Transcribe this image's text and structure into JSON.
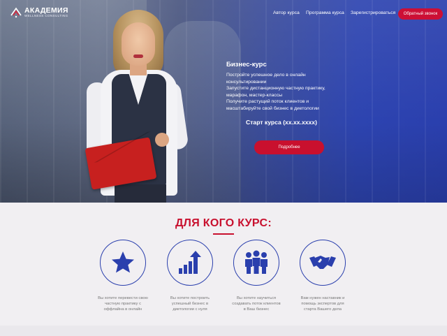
{
  "header": {
    "logo": {
      "name": "АКАДЕМИЯ",
      "subtitle": "WELLNESS CONSULTING",
      "icon": "academy-logo-icon"
    },
    "nav": [
      {
        "label": "Автор курса"
      },
      {
        "label": "Программа курса"
      },
      {
        "label": "Зарегистрироваться"
      }
    ],
    "callback_button": "Обратный звонок"
  },
  "hero": {
    "title": "Бизнес-курс",
    "description_lines": [
      "Постройте успешное дело в онлайн",
      "консультировании",
      "Запустите дистанционную частную практику,",
      "марафон, мастер-классы",
      "Получите растущий поток клиентов и",
      "масштабируйте свой бизнес в диетологии"
    ],
    "start": "Старт курса (xx.xx.xxxx)",
    "details_button": "Подробнее"
  },
  "audience": {
    "title": "ДЛЯ КОГО КУРС:",
    "items": [
      {
        "icon": "star-icon",
        "lines": [
          "Вы хотите перевести свою",
          "частную практику с",
          "оффлайна в онлайн"
        ]
      },
      {
        "icon": "growth-chart-icon",
        "lines": [
          "Вы хотите построить",
          "успешный бизнес в",
          "диетологии с нуля"
        ]
      },
      {
        "icon": "team-icon",
        "lines": [
          "Вы хотите научиться",
          "создавать поток клиентов",
          "в Ваш бизнес"
        ]
      },
      {
        "icon": "handshake-icon",
        "lines": [
          "Вам нужен наставник и",
          "помощь экспертов для",
          "старта Вашего дела"
        ]
      }
    ]
  },
  "colors": {
    "accent": "#c8102e",
    "brand_blue": "#2a3fad"
  }
}
